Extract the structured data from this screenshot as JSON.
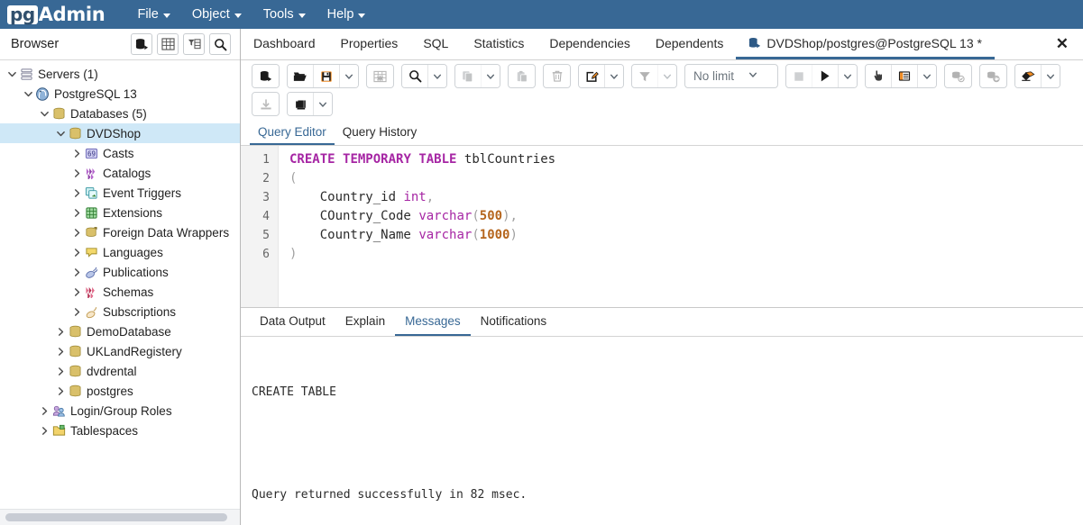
{
  "app": {
    "logo_pg": "pg",
    "logo_admin": "Admin",
    "brand_color": "#386895",
    "accent_color": "#386895",
    "selection_color": "#cfe8f7"
  },
  "menubar": {
    "items": [
      {
        "label": "File",
        "icon": "chevron-down-icon"
      },
      {
        "label": "Object",
        "icon": "chevron-down-icon"
      },
      {
        "label": "Tools",
        "icon": "chevron-down-icon"
      },
      {
        "label": "Help",
        "icon": "chevron-down-icon"
      }
    ]
  },
  "browser": {
    "title": "Browser",
    "header_buttons": [
      {
        "name": "browser-object-button",
        "icon": "database-stack-icon"
      },
      {
        "name": "browser-grid-button",
        "icon": "grid-icon"
      },
      {
        "name": "browser-filter-button",
        "icon": "filter-table-icon"
      },
      {
        "name": "browser-search-button",
        "icon": "search-icon"
      }
    ],
    "tree": [
      {
        "label": "Servers (1)",
        "indent": 0,
        "state": "expanded",
        "icon": "servers-icon",
        "selected": false
      },
      {
        "label": "PostgreSQL 13",
        "indent": 1,
        "state": "expanded",
        "icon": "postgres-icon",
        "selected": false
      },
      {
        "label": "Databases (5)",
        "indent": 2,
        "state": "expanded",
        "icon": "database-icon",
        "selected": false
      },
      {
        "label": "DVDShop",
        "indent": 3,
        "state": "expanded",
        "icon": "database-icon",
        "selected": true
      },
      {
        "label": "Casts",
        "indent": 4,
        "state": "collapsed",
        "icon": "casts-icon",
        "selected": false
      },
      {
        "label": "Catalogs",
        "indent": 4,
        "state": "collapsed",
        "icon": "catalogs-icon",
        "selected": false
      },
      {
        "label": "Event Triggers",
        "indent": 4,
        "state": "collapsed",
        "icon": "event-trigger-icon",
        "selected": false
      },
      {
        "label": "Extensions",
        "indent": 4,
        "state": "collapsed",
        "icon": "extension-icon",
        "selected": false
      },
      {
        "label": "Foreign Data Wrappers",
        "indent": 4,
        "state": "collapsed",
        "icon": "fdw-icon",
        "selected": false
      },
      {
        "label": "Languages",
        "indent": 4,
        "state": "collapsed",
        "icon": "language-icon",
        "selected": false
      },
      {
        "label": "Publications",
        "indent": 4,
        "state": "collapsed",
        "icon": "publication-icon",
        "selected": false
      },
      {
        "label": "Schemas",
        "indent": 4,
        "state": "collapsed",
        "icon": "schema-icon",
        "selected": false
      },
      {
        "label": "Subscriptions",
        "indent": 4,
        "state": "collapsed",
        "icon": "subscription-icon",
        "selected": false
      },
      {
        "label": "DemoDatabase",
        "indent": 3,
        "state": "collapsed",
        "icon": "database-icon",
        "selected": false
      },
      {
        "label": "UKLandRegistery",
        "indent": 3,
        "state": "collapsed",
        "icon": "database-icon",
        "selected": false
      },
      {
        "label": "dvdrental",
        "indent": 3,
        "state": "collapsed",
        "icon": "database-icon",
        "selected": false
      },
      {
        "label": "postgres",
        "indent": 3,
        "state": "collapsed",
        "icon": "database-icon",
        "selected": false
      },
      {
        "label": "Login/Group Roles",
        "indent": 2,
        "state": "collapsed",
        "icon": "roles-icon",
        "selected": false
      },
      {
        "label": "Tablespaces",
        "indent": 2,
        "state": "collapsed",
        "icon": "tablespace-icon",
        "selected": false
      }
    ]
  },
  "object_tabs": {
    "items": [
      {
        "label": "Dashboard",
        "active": false,
        "icon": null
      },
      {
        "label": "Properties",
        "active": false,
        "icon": null
      },
      {
        "label": "SQL",
        "active": false,
        "icon": null
      },
      {
        "label": "Statistics",
        "active": false,
        "icon": null
      },
      {
        "label": "Dependencies",
        "active": false,
        "icon": null
      },
      {
        "label": "Dependents",
        "active": false,
        "icon": null
      },
      {
        "label": "DVDShop/postgres@PostgreSQL 13 *",
        "active": true,
        "icon": "query-tool-icon"
      }
    ],
    "close_label": "✕"
  },
  "query_toolbar": {
    "groups": [
      {
        "buttons": [
          {
            "name": "open-query-tool-button",
            "icon": "query-tool-icon",
            "disabled": false
          }
        ]
      },
      {
        "buttons": [
          {
            "name": "open-file-button",
            "icon": "folder-open-icon",
            "disabled": false
          },
          {
            "name": "save-file-button",
            "icon": "save-icon",
            "disabled": false
          },
          {
            "name": "save-file-dropdown",
            "icon": "chevron-down-icon",
            "disabled": false,
            "dd": true
          }
        ]
      },
      {
        "buttons": [
          {
            "name": "edit-grid-button",
            "icon": "table-edit-icon",
            "disabled": true
          }
        ]
      },
      {
        "buttons": [
          {
            "name": "find-button",
            "icon": "search-icon",
            "disabled": false
          },
          {
            "name": "find-dropdown",
            "icon": "chevron-down-icon",
            "disabled": false,
            "dd": true
          }
        ]
      },
      {
        "buttons": [
          {
            "name": "copy-button",
            "icon": "copy-icon",
            "disabled": true
          },
          {
            "name": "copy-dropdown",
            "icon": "chevron-down-icon",
            "disabled": false,
            "dd": true
          }
        ]
      },
      {
        "buttons": [
          {
            "name": "paste-button",
            "icon": "paste-icon",
            "disabled": true
          }
        ]
      },
      {
        "buttons": [
          {
            "name": "delete-row-button",
            "icon": "trash-icon",
            "disabled": true
          }
        ]
      },
      {
        "buttons": [
          {
            "name": "edit-button",
            "icon": "pencil-edit-icon",
            "disabled": false
          },
          {
            "name": "edit-dropdown",
            "icon": "chevron-down-icon",
            "disabled": false,
            "dd": true
          }
        ]
      },
      {
        "buttons": [
          {
            "name": "filter-button",
            "icon": "funnel-icon",
            "disabled": true
          },
          {
            "name": "filter-dropdown",
            "icon": "chevron-down-icon",
            "disabled": true,
            "dd": true
          }
        ]
      }
    ],
    "row_limit": {
      "name": "row-limit-select",
      "value": "No limit",
      "icon": "chevron-down-icon"
    },
    "groups_right": [
      {
        "buttons": [
          {
            "name": "stop-query-button",
            "icon": "stop-square-icon",
            "disabled": true
          },
          {
            "name": "execute-query-button",
            "icon": "play-icon",
            "disabled": false
          },
          {
            "name": "execute-dropdown",
            "icon": "chevron-down-icon",
            "disabled": false,
            "dd": true
          }
        ]
      },
      {
        "buttons": [
          {
            "name": "explain-button",
            "icon": "hand-pointer-icon",
            "disabled": false
          },
          {
            "name": "explain-analyze-button",
            "icon": "explain-table-icon",
            "disabled": false
          },
          {
            "name": "explain-options-dropdown",
            "icon": "chevron-down-icon",
            "disabled": false,
            "dd": true
          }
        ]
      },
      {
        "buttons": [
          {
            "name": "commit-button",
            "icon": "commit-icon",
            "disabled": true
          }
        ]
      },
      {
        "buttons": [
          {
            "name": "rollback-button",
            "icon": "rollback-icon",
            "disabled": true
          }
        ]
      },
      {
        "buttons": [
          {
            "name": "clear-button",
            "icon": "eraser-icon",
            "disabled": false
          },
          {
            "name": "clear-dropdown",
            "icon": "chevron-down-icon",
            "disabled": false,
            "dd": true
          }
        ]
      }
    ],
    "row2": [
      {
        "buttons": [
          {
            "name": "download-csv-button",
            "icon": "download-icon",
            "disabled": true
          }
        ]
      },
      {
        "buttons": [
          {
            "name": "macros-button",
            "icon": "macro-icon",
            "disabled": false
          },
          {
            "name": "macros-dropdown",
            "icon": "chevron-down-icon",
            "disabled": false,
            "dd": true
          }
        ]
      }
    ]
  },
  "editor_tabs": {
    "items": [
      {
        "label": "Query Editor",
        "active": true
      },
      {
        "label": "Query History",
        "active": false
      }
    ]
  },
  "editor": {
    "line_numbers": [
      "1",
      "2",
      "3",
      "4",
      "5",
      "6"
    ],
    "code_lines": [
      "CREATE TEMPORARY TABLE tblCountries",
      "(",
      "    Country_id int,",
      "    COuntry_Code varchar(500),",
      "    Country_Name varchar(1000)",
      ")"
    ]
  },
  "result_tabs": {
    "items": [
      {
        "label": "Data Output",
        "active": false
      },
      {
        "label": "Explain",
        "active": false
      },
      {
        "label": "Messages",
        "active": true
      },
      {
        "label": "Notifications",
        "active": false
      }
    ]
  },
  "messages": {
    "line1": "CREATE TABLE",
    "line2": "Query returned successfully in 82 msec."
  }
}
